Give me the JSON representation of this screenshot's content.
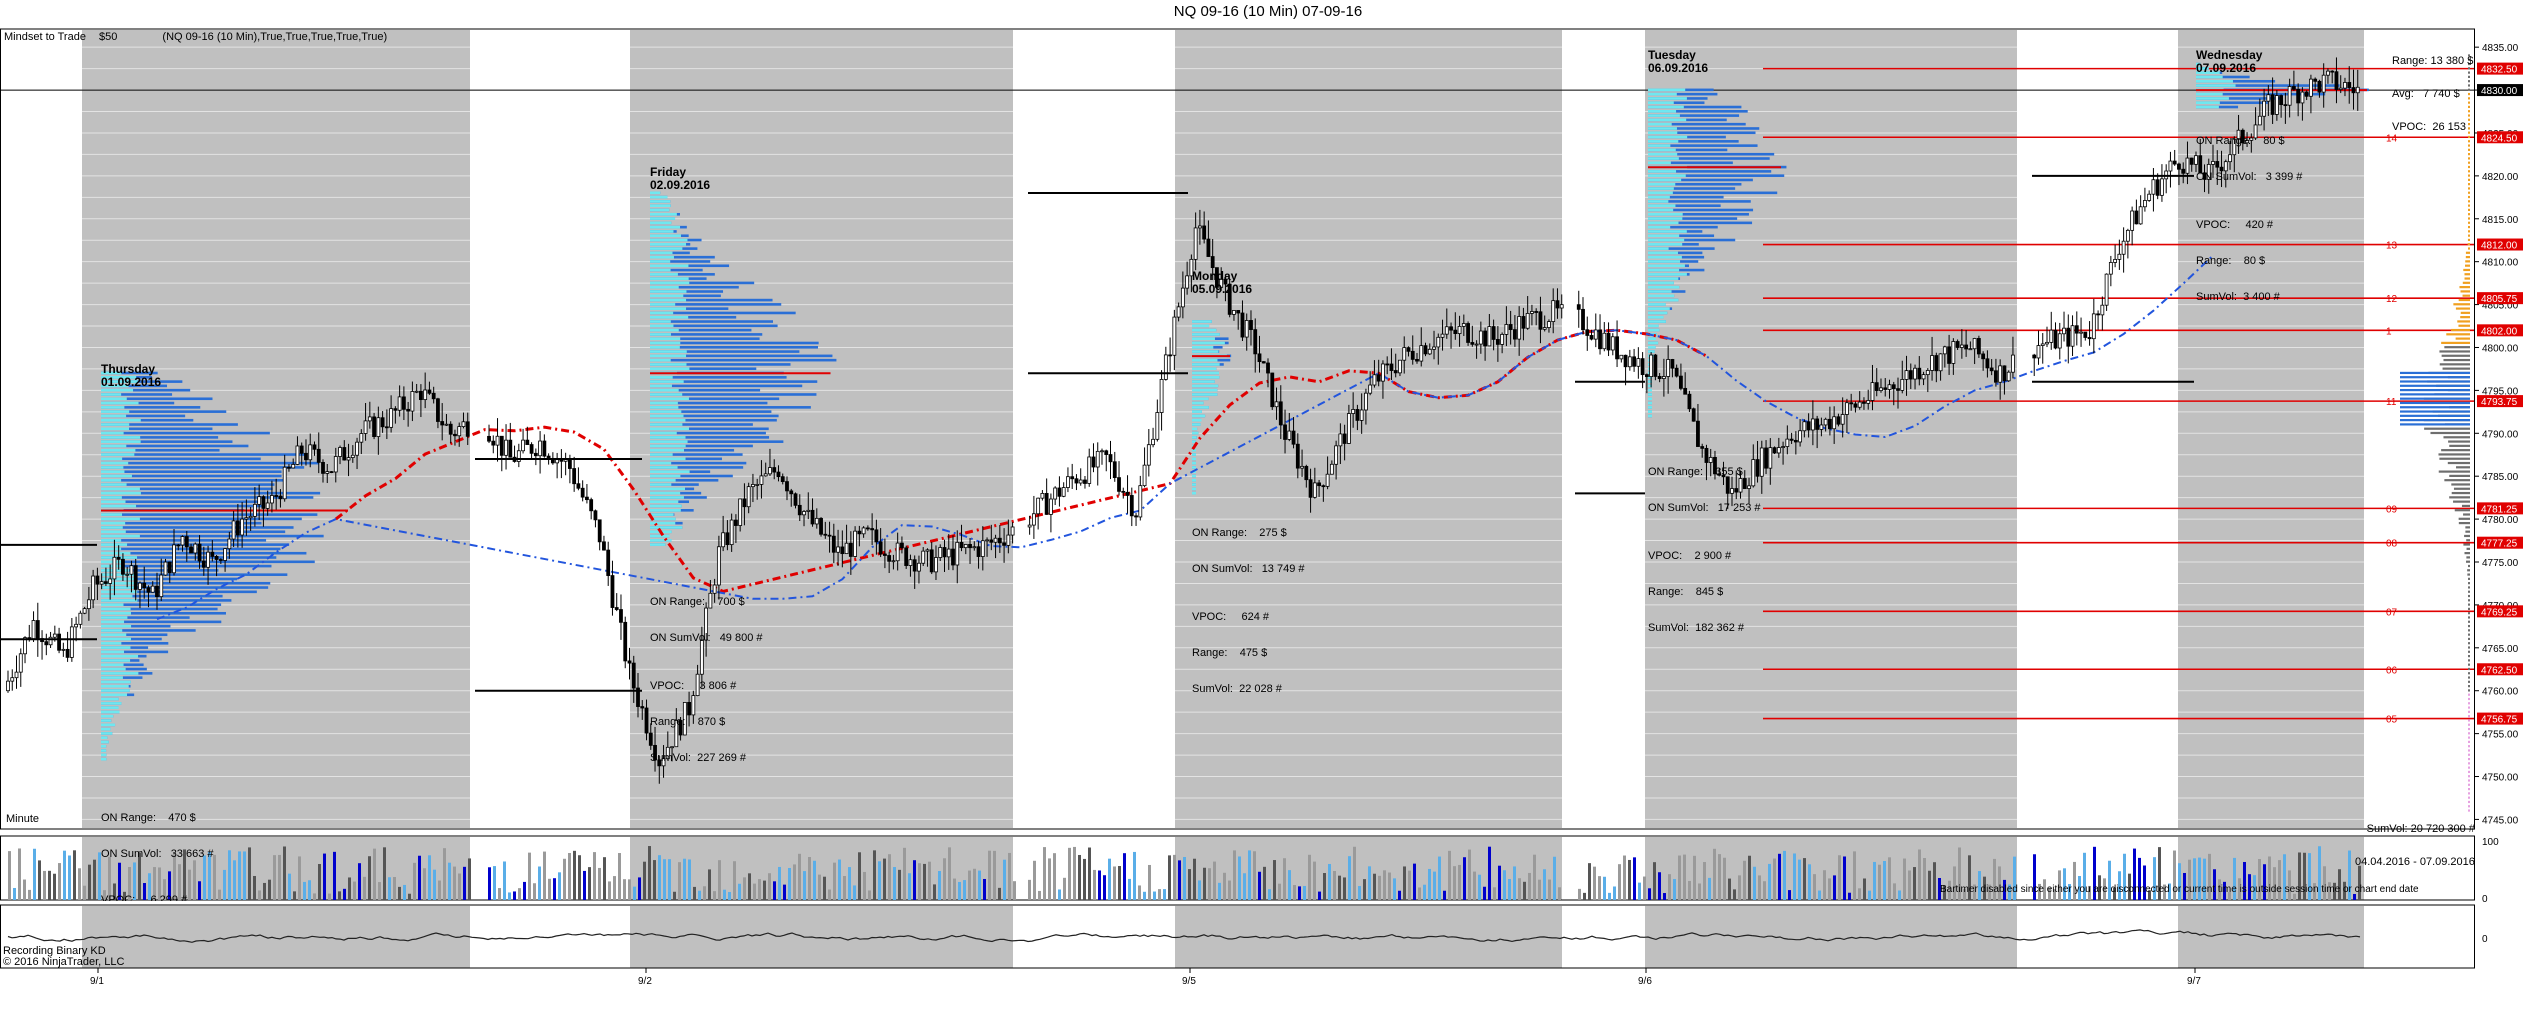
{
  "window": {
    "title": "NQ 09-16 (10 Min)  07-09-16"
  },
  "header": {
    "mindset_label": "Mindset to Trade",
    "mindset_value": "$50",
    "strategy_label": "(NQ 09-16 (10 Min),True,True,True,True,True)"
  },
  "panel_notes": {
    "minute": "Minute",
    "bartimer": "Bartimer disabled since either you are disconnected or current time is outside session time or chart end date",
    "recording": "Recording Binary KD",
    "copyright": "© 2016 NinjaTrader, LLC"
  },
  "right_stats": {
    "range": "Range: 13 380 $",
    "avg": "Avg:   7 740 $",
    "vpoc": "VPOC:  26 153",
    "sumvol": "SumVol: 20 720 300 #",
    "dates": "04.04.2016 - 07.09.2016"
  },
  "sessions": [
    {
      "day": "Thursday",
      "date": "01.09.2016",
      "on_range": "ON Range:    470 $",
      "on_sumvol": "ON SumVol:   33 663 #",
      "vpoc": "VPOC:     6 299 #"
    },
    {
      "day": "Friday",
      "date": "02.09.2016",
      "on_range": "ON Range:    700 $",
      "on_sumvol": "ON SumVol:   49 800 #",
      "vpoc": "VPOC:     3 806 #",
      "range": "Range:    870 $",
      "sumvol": "SumVol:  227 269 #"
    },
    {
      "day": "Monday",
      "date": "05.09.2016",
      "on_range": "ON Range:    275 $",
      "on_sumvol": "ON SumVol:   13 749 #",
      "vpoc": "VPOC:     624 #",
      "range": "Range:    475 $",
      "sumvol": "SumVol:  22 028 #"
    },
    {
      "day": "Tuesday",
      "date": "06.09.2016",
      "on_range": "ON Range:    355 $",
      "on_sumvol": "ON SumVol:   17 253 #",
      "vpoc": "VPOC:    2 900 #",
      "range": "Range:    845 $",
      "sumvol": "SumVol:  182 362 #"
    },
    {
      "day": "Wednesday",
      "date": "07.09.2016",
      "on_range": "ON Range:    80 $",
      "on_sumvol": "ON SumVol:   3 399 #",
      "vpoc": "VPOC:     420 #",
      "range": "Range:    80 $",
      "sumvol": "SumVol:  3 400 #"
    }
  ],
  "colors": {
    "session_shade": "#c0c0c0",
    "candle": "#000000",
    "vwap_red": "#e00000",
    "vwap_blue": "#2255dd",
    "profile_blue": "#2a6fd6",
    "profile_cyan": "#6ee8f0",
    "level_red": "#e00000",
    "price_marker_red": "#e00000"
  },
  "chart_data": {
    "type": "candlestick",
    "instrument": "NQ 09-16",
    "interval": "10 Min",
    "x_ticks": [
      "9/1",
      "9/2",
      "9/5",
      "9/6",
      "9/7"
    ],
    "y_ticks": [
      4745,
      4750,
      4755,
      4760,
      4765,
      4770,
      4775,
      4780,
      4785,
      4790,
      4795,
      4800,
      4805,
      4810,
      4815,
      4820,
      4825,
      4830,
      4835
    ],
    "y_tick_labels": [
      "4745.00",
      "4750.00",
      "4755.00",
      "4760.00",
      "4765.00",
      "4770.00",
      "4775.00",
      "4780.00",
      "4785.00",
      "4790.00",
      "4795.00",
      "4800.00",
      "4805.00",
      "4810.00",
      "4815.00",
      "4820.00",
      "4825.00",
      "4830.00",
      "4835.00"
    ],
    "ylim": [
      4744,
      4837
    ],
    "last_price": "4830.00",
    "level_markers": [
      {
        "value": 4832.5,
        "text": "4832.50",
        "tag": ""
      },
      {
        "value": 4824.5,
        "text": "4824.50",
        "tag": "14"
      },
      {
        "value": 4812.0,
        "text": "4812.00",
        "tag": "13"
      },
      {
        "value": 4805.75,
        "text": "4805.75",
        "tag": "12"
      },
      {
        "value": 4802.0,
        "text": "4802.00",
        "tag": "1"
      },
      {
        "value": 4793.75,
        "text": "4793.75",
        "tag": "11"
      },
      {
        "value": 4781.25,
        "text": "4781.25",
        "tag": "09"
      },
      {
        "value": 4777.25,
        "text": "4777.25",
        "tag": "08"
      },
      {
        "value": 4769.25,
        "text": "4769.25",
        "tag": "07"
      },
      {
        "value": 4762.5,
        "text": "4762.50",
        "tag": "06"
      },
      {
        "value": 4756.75,
        "text": "4756.75",
        "tag": "05"
      }
    ],
    "price_series": [
      [
        0,
        4760
      ],
      [
        1,
        4768
      ],
      [
        2,
        4764
      ],
      [
        3,
        4772
      ],
      [
        4,
        4775
      ],
      [
        5,
        4771
      ],
      [
        6,
        4778
      ],
      [
        7,
        4775
      ],
      [
        8,
        4780
      ],
      [
        9,
        4782
      ],
      [
        10,
        4788
      ],
      [
        11,
        4786
      ],
      [
        12,
        4790
      ],
      [
        13,
        4792
      ],
      [
        14,
        4795
      ],
      [
        15,
        4790
      ],
      [
        16,
        4792
      ],
      [
        17,
        4787
      ],
      [
        18,
        4789
      ],
      [
        19,
        4786
      ],
      [
        20,
        4778
      ],
      [
        21,
        4762
      ],
      [
        22,
        4752
      ],
      [
        23,
        4758
      ],
      [
        24,
        4776
      ],
      [
        25,
        4783
      ],
      [
        26,
        4786
      ],
      [
        27,
        4780
      ],
      [
        28,
        4776
      ],
      [
        29,
        4778
      ],
      [
        30,
        4776
      ],
      [
        31,
        4775
      ],
      [
        32,
        4776
      ],
      [
        33,
        4777
      ],
      [
        34,
        4779
      ],
      [
        35,
        4782
      ],
      [
        36,
        4785
      ],
      [
        37,
        4787
      ],
      [
        38,
        4781
      ],
      [
        39,
        4798
      ],
      [
        40,
        4814
      ],
      [
        41,
        4806
      ],
      [
        42,
        4800
      ],
      [
        43,
        4790
      ],
      [
        44,
        4783
      ],
      [
        45,
        4790
      ],
      [
        46,
        4796
      ],
      [
        47,
        4799
      ],
      [
        48,
        4801
      ],
      [
        49,
        4802
      ],
      [
        50,
        4801
      ],
      [
        51,
        4803
      ],
      [
        52,
        4804
      ],
      [
        53,
        4803
      ],
      [
        54,
        4800
      ],
      [
        55,
        4798
      ],
      [
        56,
        4797
      ],
      [
        57,
        4788
      ],
      [
        58,
        4783
      ],
      [
        59,
        4787
      ],
      [
        60,
        4790
      ],
      [
        61,
        4791
      ],
      [
        62,
        4793
      ],
      [
        63,
        4795
      ],
      [
        64,
        4797
      ],
      [
        65,
        4799
      ],
      [
        66,
        4800
      ],
      [
        67,
        4797
      ],
      [
        68,
        4800
      ],
      [
        69,
        4801
      ],
      [
        70,
        4802
      ],
      [
        71,
        4812
      ],
      [
        72,
        4818
      ],
      [
        73,
        4822
      ],
      [
        74,
        4820
      ],
      [
        75,
        4824
      ],
      [
        76,
        4828
      ],
      [
        77,
        4830
      ],
      [
        78,
        4831
      ],
      [
        79,
        4830
      ]
    ],
    "volume_axis": [
      "100",
      "0"
    ],
    "oscillator_axis": [
      "0"
    ]
  }
}
